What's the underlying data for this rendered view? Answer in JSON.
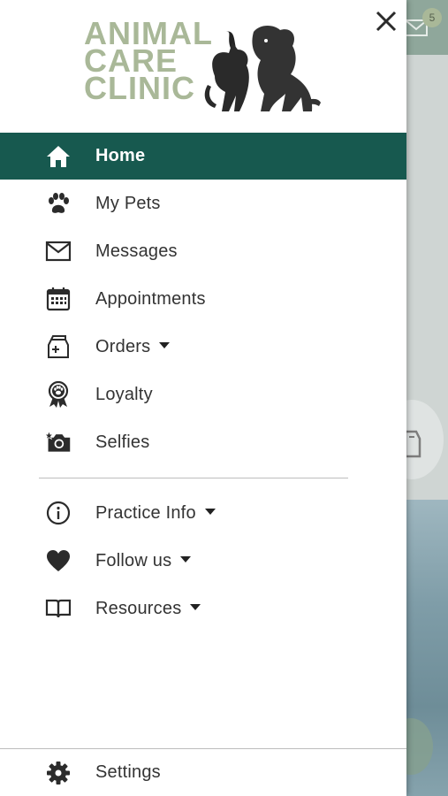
{
  "drawer": {
    "logo": {
      "line1": "ANIMAL",
      "line2": "CARE",
      "line3": "CLINIC"
    },
    "menu_items": [
      {
        "label": "Home",
        "icon": "home-icon",
        "active": true
      },
      {
        "label": "My Pets",
        "icon": "paw-icon"
      },
      {
        "label": "Messages",
        "icon": "envelope-icon"
      },
      {
        "label": "Appointments",
        "icon": "calendar-icon"
      },
      {
        "label": "Orders",
        "icon": "food-bag-icon",
        "expandable": true
      },
      {
        "label": "Loyalty",
        "icon": "award-ribbon-icon"
      },
      {
        "label": "Selfies",
        "icon": "camera-icon"
      }
    ],
    "secondary_items": [
      {
        "label": "Practice Info",
        "icon": "info-icon",
        "expandable": true
      },
      {
        "label": "Follow us",
        "icon": "heart-icon",
        "expandable": true
      },
      {
        "label": "Resources",
        "icon": "book-icon",
        "expandable": true
      }
    ],
    "settings_label": "Settings"
  },
  "background": {
    "mail_badge_count": "5"
  },
  "colors": {
    "active_bg": "#17594f",
    "logo_green": "#a9b898",
    "text": "#333333"
  }
}
